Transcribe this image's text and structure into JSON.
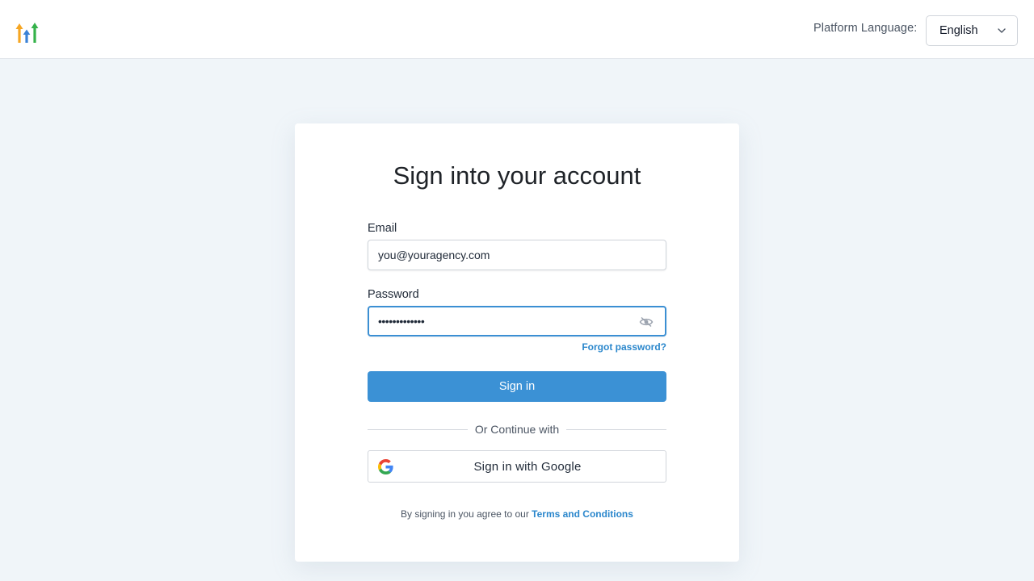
{
  "header": {
    "language_label": "Platform Language:",
    "language_value": "English"
  },
  "form": {
    "title": "Sign into your account",
    "email_label": "Email",
    "email_value": "you@youragency.com",
    "password_label": "Password",
    "password_value": "•••••••••••••",
    "forgot_link": "Forgot password?",
    "signin_button": "Sign in",
    "divider_text": "Or Continue with",
    "google_button": "Sign in with Google",
    "terms_prefix": "By signing in you agree to our",
    "terms_link": "Terms and Conditions"
  },
  "icons": {
    "logo": "brand-arrows-logo",
    "chevron": "chevron-down-icon",
    "eye": "eye-slash-icon",
    "google": "google-g-icon"
  },
  "colors": {
    "accent": "#3b91d5",
    "link": "#2b87cc",
    "background": "#f0f5f9"
  }
}
